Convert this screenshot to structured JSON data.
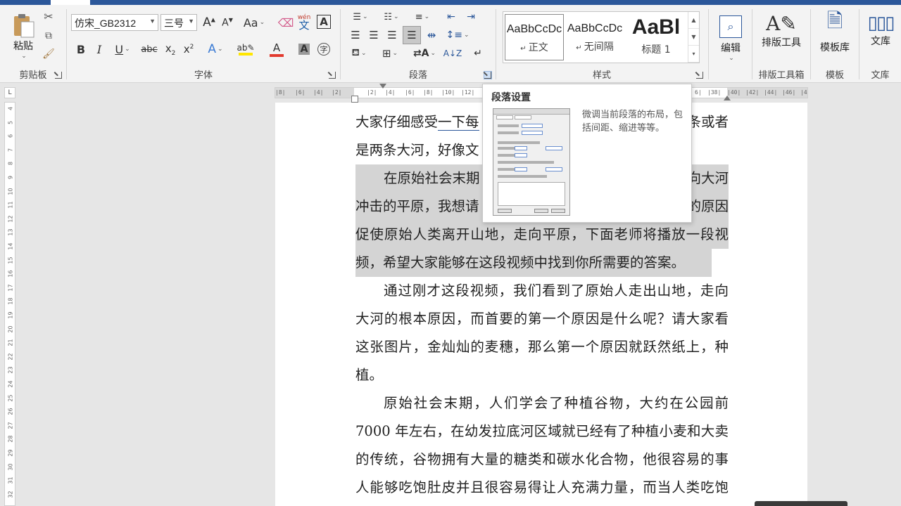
{
  "ribbon": {
    "clipboard": {
      "paste_label": "粘贴",
      "group_label": "剪贴板"
    },
    "font": {
      "font_name": "仿宋_GB2312",
      "font_size": "三号",
      "change_case_label": "Aa",
      "phonetic_top": "wén",
      "phonetic_bottom": "文",
      "border_char": "A",
      "group_label": "字体"
    },
    "paragraph": {
      "group_label": "段落"
    },
    "styles": {
      "items": [
        {
          "sample": "AaBbCcDc",
          "name": "正文"
        },
        {
          "sample": "AaBbCcDc",
          "name": "无间隔"
        },
        {
          "sample": "AaBl",
          "name": "标题 1"
        }
      ],
      "group_label": "样式"
    },
    "editing": {
      "label": "编辑"
    },
    "typeset": {
      "label": "排版工具",
      "group_label": "排版工具箱"
    },
    "template": {
      "label": "模板库",
      "group_label": "模板"
    },
    "library": {
      "label": "文库",
      "group_label": "文库"
    }
  },
  "tooltip": {
    "title": "段落设置",
    "description": "微调当前段落的布局，包括间距、缩进等等。"
  },
  "ruler": {
    "left_labels": [
      "|8|",
      "|6|",
      "|4|",
      "|2|"
    ],
    "main_labels": [
      "|2|",
      "|4|",
      "|6|",
      "|8|",
      "|10|",
      "|12|",
      "|1"
    ],
    "right_labels": [
      "6|",
      "|38|",
      "|40|",
      "|42|",
      "|44|",
      "|46|",
      "|48"
    ],
    "vertical_numbers": [
      "4",
      "5",
      "6",
      "7",
      "8",
      "9",
      "10",
      "11",
      "12",
      "13",
      "14",
      "15",
      "16",
      "17",
      "18",
      "19",
      "20",
      "21",
      "22",
      "23",
      "24",
      "25",
      "26",
      "27",
      "28",
      "29",
      "30",
      "31",
      "32"
    ]
  },
  "document": {
    "p1": {
      "l1_a": "大家仔细感受",
      "l1_u": "一下每",
      "l1_b": "条或者",
      "l2": "是两条大河，好像文"
    },
    "p2": {
      "l1_a": "在原始社会末期",
      "l1_b": "向大河",
      "l2_a": "冲击的平原，我想请",
      "l2_b": "的原因",
      "l3": "促使原始人类离开山地，走向平原，下面老师将播放一段视",
      "l4": "频，希望大家能够在这段视频中找到你所需要的答案。"
    },
    "p3": {
      "l1": "通过刚才这段视频，我们看到了原始人走出山地，走向",
      "l2": "大河的根本原因，而首要的第一个原因是什么呢？请大家看",
      "l3": "这张图片，金灿灿的麦穗，那么第一个原因就跃然纸上，种",
      "l4": "植。"
    },
    "p4": {
      "l1": "原始社会末期，人们学会了种植谷物，大约在公园前",
      "l2": "7000 年左右，在幼发拉底河区域就已经有了种植小麦和大卖",
      "l3": "的传统，谷物拥有大量的糖类和碳水化合物，他很容易的事",
      "l4": "人能够吃饱肚皮并且很容易得让人充满力量，而当人类吃饱"
    }
  },
  "colors": {
    "accent": "#2b579a",
    "highlight": "#d4d4d4",
    "font_color_bar": "#e23a2e",
    "highlight_bar": "#ffe600"
  }
}
